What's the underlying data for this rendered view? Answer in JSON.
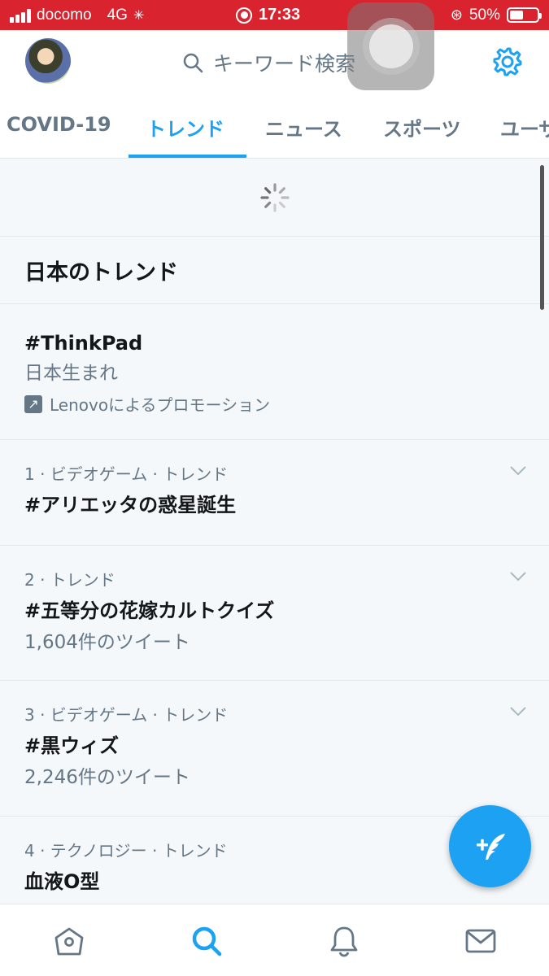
{
  "status_bar": {
    "carrier": "docomo",
    "network": "4G",
    "time": "17:33",
    "battery": "50%",
    "battery_level": 0.5,
    "background_color": "#d9242f"
  },
  "header": {
    "search_placeholder": "キーワード検索",
    "avatar_icon": "user-avatar",
    "settings_icon": "gear-icon"
  },
  "tabs": [
    {
      "label": "COVID-19",
      "active": false
    },
    {
      "label": "トレンド",
      "active": true
    },
    {
      "label": "ニュース",
      "active": false
    },
    {
      "label": "スポーツ",
      "active": false
    },
    {
      "label": "ユーザ",
      "active": false
    }
  ],
  "section_title": "日本のトレンド",
  "promoted": {
    "name": "#ThinkPad",
    "description": "日本生まれ",
    "promotion": "Lenovoによるプロモーション"
  },
  "trends": [
    {
      "meta": "1 · ビデオゲーム · トレンド",
      "name": "#アリエッタの惑星誕生",
      "count": ""
    },
    {
      "meta": "2 · トレンド",
      "name": "#五等分の花嫁カルトクイズ",
      "count": "1,604件のツイート"
    },
    {
      "meta": "3 · ビデオゲーム · トレンド",
      "name": "#黒ウィズ",
      "count": "2,246件のツイート"
    },
    {
      "meta": "4 · テクノロジー · トレンド",
      "name": "血液O型",
      "count": ""
    }
  ],
  "colors": {
    "accent": "#1da1f2",
    "text_primary": "#14171a",
    "text_secondary": "#657786"
  },
  "bottom_nav": [
    "home-icon",
    "search-icon",
    "bell-icon",
    "mail-icon"
  ]
}
